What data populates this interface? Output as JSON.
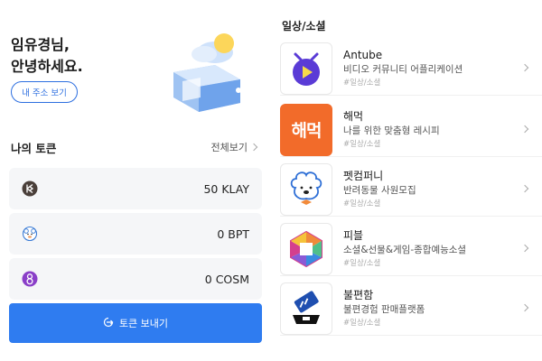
{
  "greeting": {
    "line1": "임유경님,",
    "line2": "안녕하세요."
  },
  "address_button": "내 주소 보기",
  "tokens_section": {
    "title": "나의 토큰",
    "see_all": "전체보기",
    "items": [
      {
        "icon": "klay-icon",
        "value": "50 KLAY"
      },
      {
        "icon": "bpt-icon",
        "value": "0 BPT"
      },
      {
        "icon": "cosm-icon",
        "value": "0 COSM"
      }
    ]
  },
  "send_button": "토큰 보내기",
  "category": {
    "title": "일상/소셜",
    "apps": [
      {
        "name": "Antube",
        "desc": "비디오 커뮤니티 어플리케이션",
        "tag": "#일상/소셜",
        "icon": "antube-logo-icon"
      },
      {
        "name": "해먹",
        "desc": "나를 위한 맞춤형 레시피",
        "tag": "#일상/소셜",
        "icon": "haemuk-logo-icon",
        "logo_text": "해먹"
      },
      {
        "name": "펫컴퍼니",
        "desc": "반려동물 사원모집",
        "tag": "#일상/소셜",
        "icon": "petcompany-logo-icon"
      },
      {
        "name": "피블",
        "desc": "소셜&선물&게임-종합예능소셜",
        "tag": "#일상/소셜",
        "icon": "pibl-logo-icon"
      },
      {
        "name": "불편함",
        "desc": "불편경험 판매플랫폼",
        "tag": "#일상/소셜",
        "icon": "bulpyeonham-logo-icon"
      }
    ]
  },
  "colors": {
    "primary": "#2f7cf0",
    "haemuk": "#f26b2a",
    "antube": "#5a3bd6"
  }
}
